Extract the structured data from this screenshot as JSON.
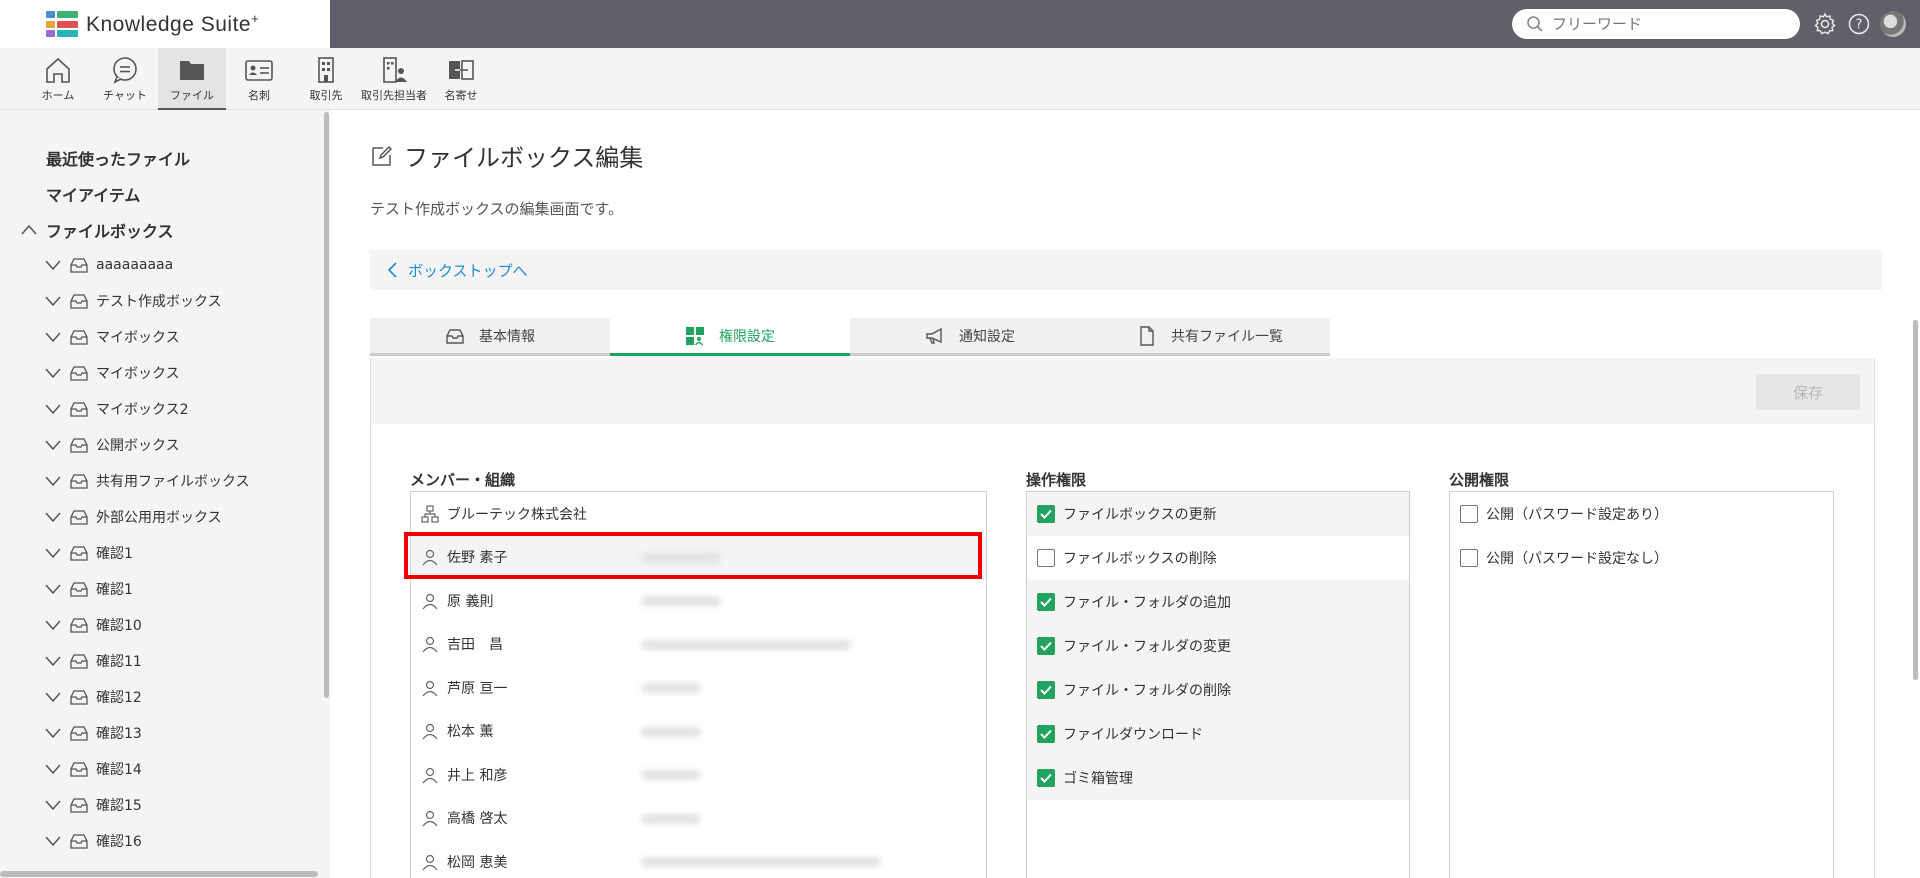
{
  "app": {
    "name": "Knowledge Suite",
    "name_sup": "+",
    "logo_colors": [
      "#4a90d9",
      "#3cb371",
      "#e8a33d",
      "#e05252",
      "#9b6bcf",
      "#2bb3b8"
    ]
  },
  "header": {
    "search_placeholder": "フリーワード"
  },
  "nav": {
    "items": [
      {
        "label": "ホーム",
        "icon": "home-icon"
      },
      {
        "label": "チャット",
        "icon": "chat-icon"
      },
      {
        "label": "ファイル",
        "icon": "folder-icon",
        "active": true
      },
      {
        "label": "名刺",
        "icon": "business-card-icon"
      },
      {
        "label": "取引先",
        "icon": "building-icon"
      },
      {
        "label": "取引先担当者",
        "icon": "building-person-icon"
      },
      {
        "label": "名寄せ",
        "icon": "merge-icon"
      }
    ]
  },
  "sidebar": {
    "recent": "最近使ったファイル",
    "my_items": "マイアイテム",
    "filebox": "ファイルボックス",
    "boxes": [
      "aaaaaaaaa",
      "テスト作成ボックス",
      "マイボックス",
      "マイボックス",
      "マイボックス2",
      "公開ボックス",
      "共有用ファイルボックス",
      "外部公用用ボックス",
      "確認1",
      "確認1",
      "確認10",
      "確認11",
      "確認12",
      "確認13",
      "確認14",
      "確認15",
      "確認16"
    ]
  },
  "main": {
    "title": "ファイルボックス編集",
    "description": "テスト作成ボックスの編集画面です。",
    "back_link": "ボックストップへ",
    "tabs": [
      {
        "label": "基本情報",
        "icon": "tray-icon"
      },
      {
        "label": "権限設定",
        "icon": "permission-icon",
        "active": true
      },
      {
        "label": "通知設定",
        "icon": "megaphone-icon"
      },
      {
        "label": "共有ファイル一覧",
        "icon": "document-icon"
      }
    ],
    "save_label": "保存",
    "members_title": "メンバー・組織",
    "members": [
      {
        "name": "ブルーテック株式会社",
        "type": "org"
      },
      {
        "name": "佐野 素子",
        "type": "person"
      },
      {
        "name": "原 義則",
        "type": "person"
      },
      {
        "name": "吉田　昌",
        "type": "person"
      },
      {
        "name": "芦原 亘一",
        "type": "person"
      },
      {
        "name": "松本 薫",
        "type": "person"
      },
      {
        "name": "井上 和彦",
        "type": "person"
      },
      {
        "name": "高橋 啓太",
        "type": "person"
      },
      {
        "name": "松岡 恵美",
        "type": "person"
      }
    ],
    "operations_title": "操作権限",
    "operations": [
      {
        "label": "ファイルボックスの更新",
        "checked": true
      },
      {
        "label": "ファイルボックスの削除",
        "checked": false
      },
      {
        "label": "ファイル・フォルダの追加",
        "checked": true
      },
      {
        "label": "ファイル・フォルダの変更",
        "checked": true
      },
      {
        "label": "ファイル・フォルダの削除",
        "checked": true
      },
      {
        "label": "ファイルダウンロード",
        "checked": true
      },
      {
        "label": "ゴミ箱管理",
        "checked": true
      }
    ],
    "public_title": "公開権限",
    "public_options": [
      {
        "label": "公開（パスワード設定あり）",
        "checked": false
      },
      {
        "label": "公開（パスワード設定なし）",
        "checked": false
      }
    ]
  },
  "colors": {
    "accent_green": "#21a25e",
    "link_blue": "#1a8fd6",
    "highlight_red": "#e00000"
  }
}
